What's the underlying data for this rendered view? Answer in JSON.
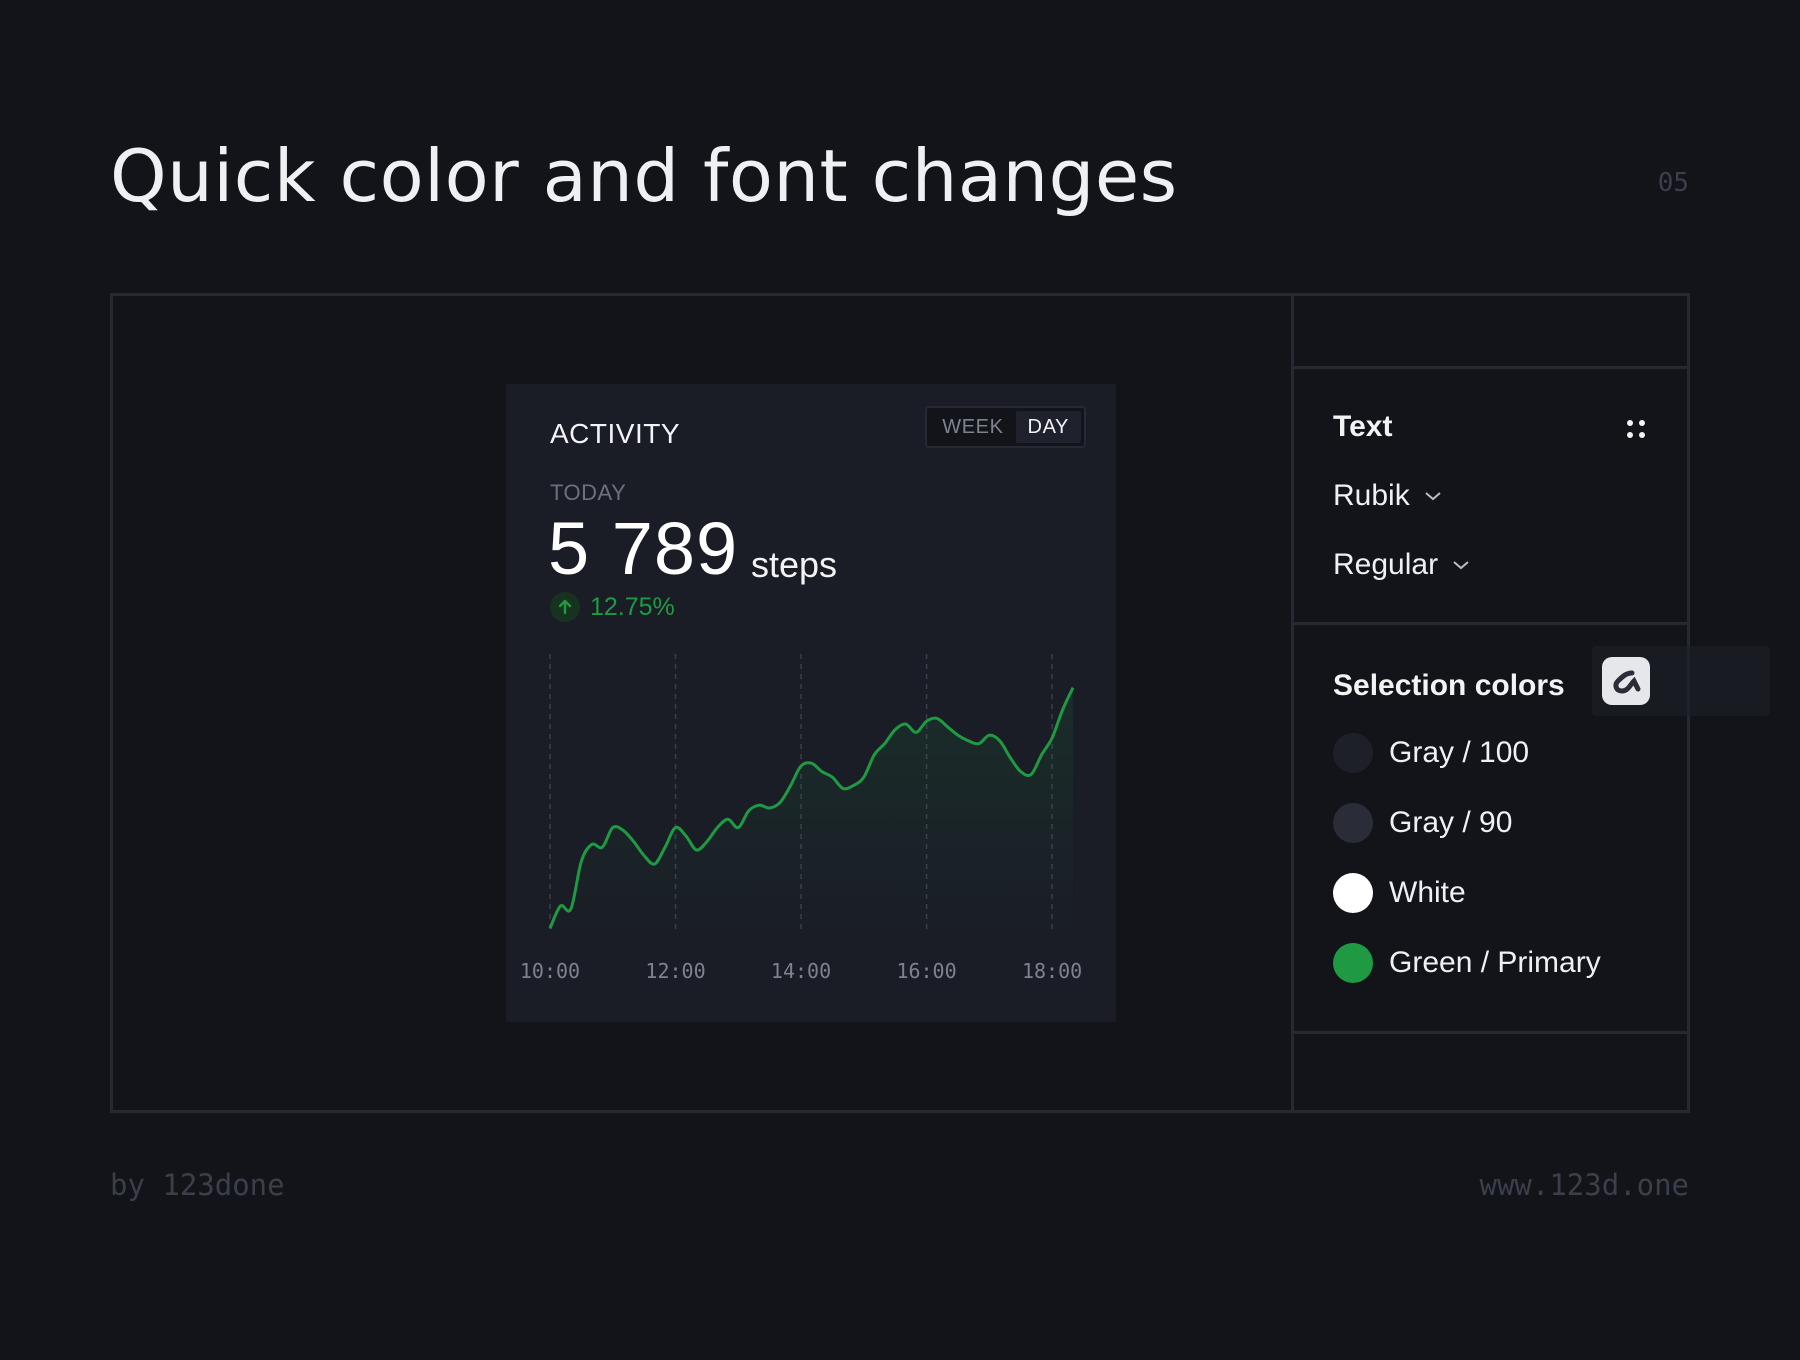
{
  "header": {
    "title": "Quick color and font changes",
    "page_number": "05"
  },
  "card": {
    "title": "ACTIVITY",
    "toggle": {
      "options": [
        "WEEK",
        "DAY"
      ],
      "selected": "DAY"
    },
    "period_label": "TODAY",
    "value": "5 789",
    "unit": "steps",
    "change": "12.75%"
  },
  "chart_data": {
    "type": "area",
    "x": [
      "10:00",
      "10:10",
      "10:20",
      "10:30",
      "10:40",
      "10:50",
      "11:00",
      "11:10",
      "11:20",
      "11:30",
      "11:40",
      "11:50",
      "12:00",
      "12:10",
      "12:20",
      "12:30",
      "12:40",
      "12:50",
      "13:00",
      "13:10",
      "13:20",
      "13:30",
      "13:40",
      "13:50",
      "14:00",
      "14:10",
      "14:20",
      "14:30",
      "14:40",
      "14:50",
      "15:00",
      "15:10",
      "15:20",
      "15:30",
      "15:40",
      "15:50",
      "16:00",
      "16:10",
      "16:20",
      "16:30",
      "16:40",
      "16:50",
      "17:00",
      "17:10",
      "17:20",
      "17:30",
      "17:40",
      "17:50",
      "18:00",
      "18:10",
      "18:20"
    ],
    "values": [
      2,
      10,
      9,
      26,
      32,
      31,
      38,
      37,
      33,
      28,
      25,
      31,
      38,
      35,
      30,
      33,
      38,
      41,
      38,
      44,
      46,
      45,
      47,
      53,
      60,
      61,
      58,
      56,
      52,
      53,
      56,
      64,
      68,
      73,
      75,
      72,
      76,
      77,
      74,
      71,
      69,
      68,
      71,
      69,
      63,
      58,
      57,
      64,
      70,
      80,
      88
    ],
    "tick_labels": [
      "10:00",
      "12:00",
      "14:00",
      "16:00",
      "18:00"
    ],
    "ylim": [
      0,
      100
    ],
    "color": "#1f9a42",
    "grid": "vertical-dashed"
  },
  "panel": {
    "text_section": {
      "heading": "Text",
      "font_family": "Rubik",
      "font_weight": "Regular"
    },
    "colors_section": {
      "heading": "Selection colors",
      "colors": [
        {
          "name": "Gray / 100",
          "hex": "#1e2029"
        },
        {
          "name": "Gray / 90",
          "hex": "#2a2d38"
        },
        {
          "name": "White",
          "hex": "#ffffff"
        },
        {
          "name": "Green / Primary",
          "hex": "#1f9a42"
        }
      ]
    }
  },
  "footer": {
    "credit": "by 123done",
    "url": "www.123d.one"
  }
}
